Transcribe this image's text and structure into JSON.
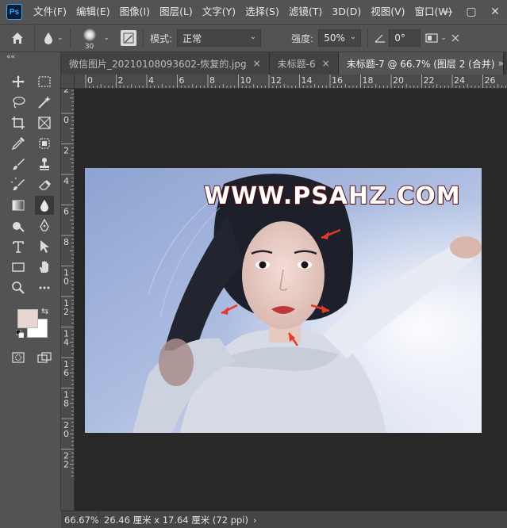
{
  "app": {
    "logo": "Ps"
  },
  "menu": [
    "文件(F)",
    "编辑(E)",
    "图像(I)",
    "图层(L)",
    "文字(Y)",
    "选择(S)",
    "滤镜(T)",
    "3D(D)",
    "视图(V)",
    "窗口(W)"
  ],
  "window_controls": {
    "minimize": "—",
    "restore": "▢",
    "close": "✕"
  },
  "options": {
    "brush_size": "30",
    "mode_label": "模式:",
    "mode_value": "正常",
    "strength_label": "强度:",
    "strength_value": "50%",
    "angle_value": "0°"
  },
  "tabs": [
    {
      "label": "微信图片_20210108093602-恢复的.jpg",
      "active": false
    },
    {
      "label": "未标题-6",
      "active": false
    },
    {
      "label": "未标题-7 @ 66.7% (图层 2 (合并)",
      "active": true
    }
  ],
  "ruler": {
    "h_labels": [
      "0",
      "2",
      "4",
      "6",
      "8",
      "10",
      "12",
      "14",
      "16",
      "18",
      "20",
      "22",
      "24",
      "26"
    ],
    "v_labels": [
      "4",
      "2",
      "0",
      "2",
      "4",
      "6",
      "8",
      "10",
      "12",
      "14",
      "16",
      "18",
      "20",
      "22"
    ]
  },
  "canvas": {
    "watermark": "WWW.PSAHZ.COM"
  },
  "colors": {
    "foreground": "#e8d6d2",
    "background": "#ffffff",
    "accent": "#31a8ff",
    "arrow": "#e53a2a"
  },
  "status": {
    "zoom": "66.67%",
    "doc_info": "26.46 厘米 x 17.64 厘米 (72 ppi)",
    "arrow": "›"
  },
  "toolbar": {
    "collapse": "««",
    "tools": [
      [
        "move-tool",
        "marquee-tool"
      ],
      [
        "lasso-tool",
        "magic-wand-tool"
      ],
      [
        "crop-tool",
        "frame-tool"
      ],
      [
        "eyedropper-tool",
        "patch-tool"
      ],
      [
        "brush-tool",
        "clone-stamp-tool"
      ],
      [
        "history-brush-tool",
        "eraser-tool"
      ],
      [
        "gradient-tool",
        "blur-tool"
      ],
      [
        "dodge-tool",
        "pen-tool"
      ],
      [
        "type-tool",
        "path-selection-tool"
      ],
      [
        "rectangle-tool",
        "hand-tool"
      ],
      [
        "zoom-tool",
        "more-tools"
      ]
    ]
  }
}
